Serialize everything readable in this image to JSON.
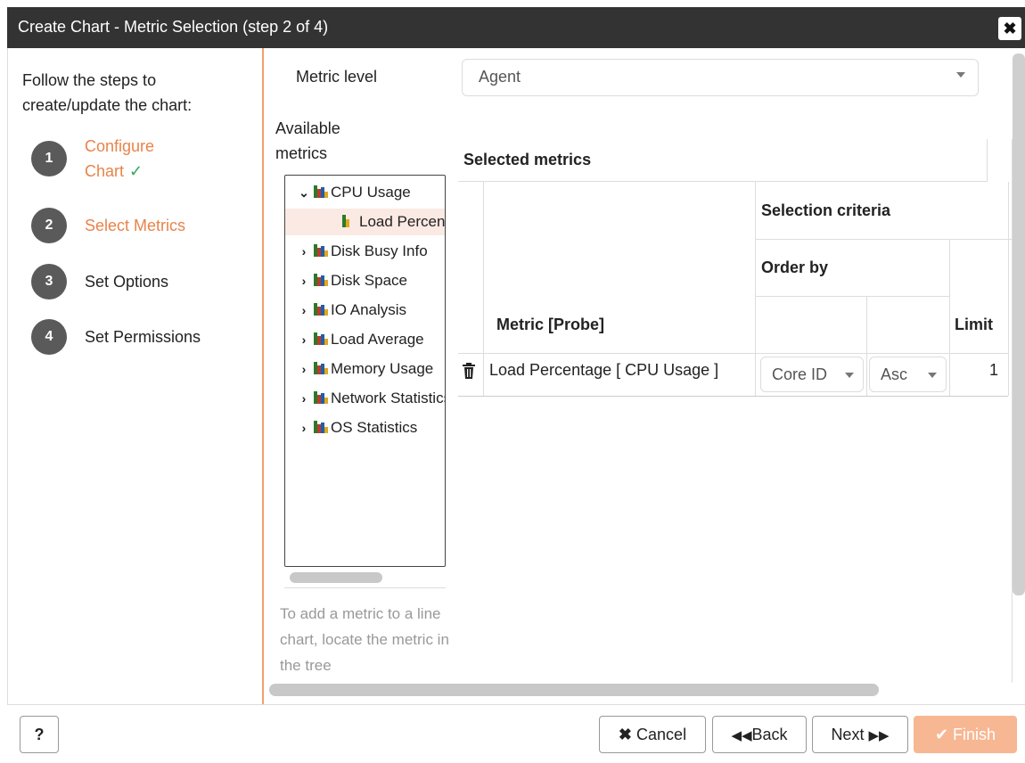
{
  "dialog": {
    "title": "Create Chart - Metric Selection (step 2 of 4)",
    "close_label": "✖"
  },
  "steps": {
    "intro": "Follow the steps to create/update the chart:",
    "items": [
      {
        "num": "1",
        "label": "Configure Chart",
        "check": "✓",
        "state": "done"
      },
      {
        "num": "2",
        "label": "Select Metrics",
        "state": "active"
      },
      {
        "num": "3",
        "label": "Set Options",
        "state": "pending"
      },
      {
        "num": "4",
        "label": "Set Permissions",
        "state": "pending"
      }
    ]
  },
  "metric_level": {
    "label": "Metric level",
    "value": "Agent"
  },
  "available_metrics": {
    "label": "Available metrics",
    "tree": [
      {
        "label": "CPU Usage",
        "chevron": "⌄",
        "expanded": true,
        "icon": "bar-chart-icon"
      },
      {
        "label": "Load Percentage",
        "icon": "metric-bar-icon",
        "selected": true,
        "child": true
      },
      {
        "label": "Disk Busy Info",
        "chevron": "›",
        "icon": "bar-chart-icon"
      },
      {
        "label": "Disk Space",
        "chevron": "›",
        "icon": "bar-chart-icon"
      },
      {
        "label": "IO Analysis",
        "chevron": "›",
        "icon": "bar-chart-icon"
      },
      {
        "label": "Load Average",
        "chevron": "›",
        "icon": "bar-chart-icon"
      },
      {
        "label": "Memory Usage",
        "chevron": "›",
        "icon": "bar-chart-icon"
      },
      {
        "label": "Network Statistics",
        "chevron": "›",
        "icon": "bar-chart-icon"
      },
      {
        "label": "OS Statistics",
        "chevron": "›",
        "icon": "bar-chart-icon"
      }
    ],
    "help": "To add a metric to a line chart, locate the metric in the tree"
  },
  "selected_metrics": {
    "title": "Selected metrics",
    "headers": {
      "metric_probe": "Metric [Probe]",
      "selection_criteria": "Selection criteria",
      "order_by": "Order by",
      "limit": "Limit"
    },
    "rows": [
      {
        "metric": "Load Percentage [ CPU Usage ]",
        "order_field": "Core ID",
        "order_dir": "Asc",
        "limit": "1"
      }
    ]
  },
  "footer": {
    "help_label": "?",
    "cancel_label": "Cancel",
    "back_label": "Back",
    "next_label": "Next",
    "finish_label": "Finish"
  },
  "colors": {
    "accent": "#e8834a",
    "success": "#3aa65b",
    "finish_disabled": "#f7b792",
    "titlebar": "#333333"
  }
}
